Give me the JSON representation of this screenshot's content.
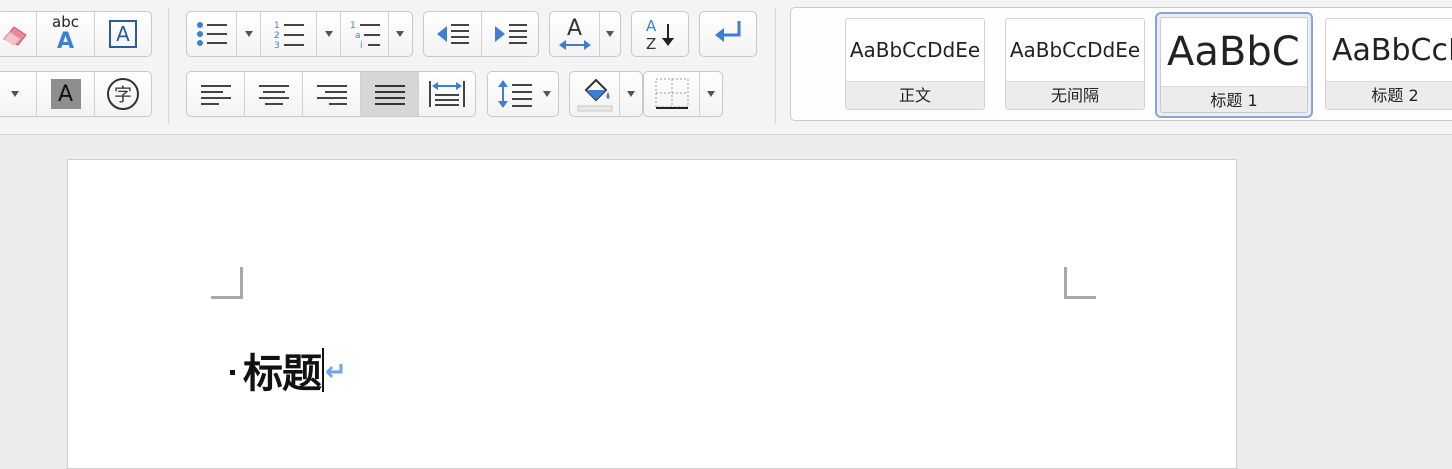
{
  "ribbon": {
    "clear_format_label": "clear formatting",
    "phonetic_abc": "abc",
    "phonetic_A": "A",
    "char_border_letter": "A",
    "char_shading_letter": "A",
    "enclose_char": "字"
  },
  "styles": [
    {
      "preview": "AaBbCcDdEe",
      "label": "正文",
      "selected": false
    },
    {
      "preview": "AaBbCcDdEe",
      "label": "无间隔",
      "selected": false
    },
    {
      "preview": "AaBbC",
      "label": "标题 1",
      "selected": true
    },
    {
      "preview": "AaBbCcD",
      "label": "标题 2",
      "selected": false
    }
  ],
  "document": {
    "heading_text": "标题",
    "paragraph_mark": "↵"
  },
  "colors": {
    "accent_blue": "#3d7fd6",
    "selected_style_border": "#8aa6cf",
    "paragraph_mark": "#6aa7ea"
  }
}
